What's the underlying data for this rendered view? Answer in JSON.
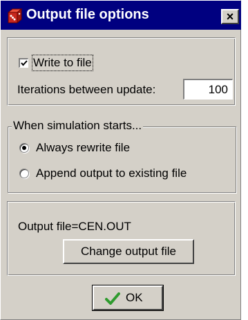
{
  "window": {
    "title": "Output file options",
    "icon": "app-icon",
    "close_label": "×",
    "colors": {
      "titlebar": "#000080",
      "face": "#d4d0c8",
      "check_mark": "#2e9b2e"
    }
  },
  "output_section": {
    "write_to_file_label": "Write to file",
    "write_to_file_checked": true,
    "iterations_label": "Iterations between update:",
    "iterations_value": "100"
  },
  "simulation_group": {
    "legend": "When simulation starts...",
    "options": [
      {
        "label": "Always rewrite file",
        "selected": true
      },
      {
        "label": "Append output to existing file",
        "selected": false
      }
    ]
  },
  "file_section": {
    "output_file_text": "Output file=CEN.OUT",
    "change_button_label": "Change output file"
  },
  "footer": {
    "ok_label": "OK",
    "ok_icon": "check-icon"
  }
}
